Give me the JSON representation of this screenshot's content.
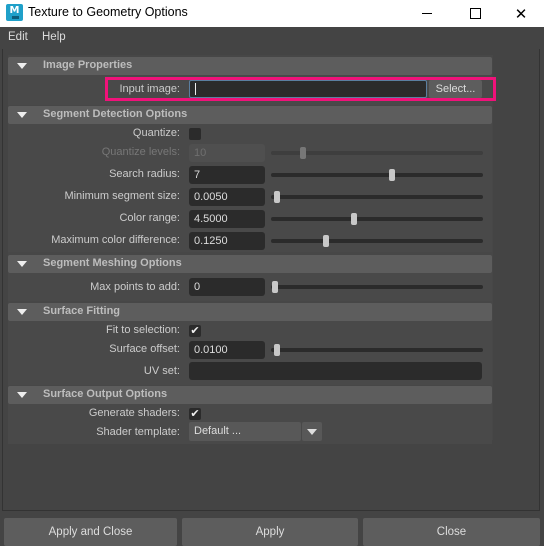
{
  "window": {
    "title": "Texture to Geometry Options",
    "app_icon_letter": "M",
    "controls": {
      "minimize": "minimize-icon",
      "maximize": "maximize-icon",
      "close": "✕"
    }
  },
  "menu": [
    "Edit",
    "Help"
  ],
  "sections": {
    "image_properties": {
      "title": "Image Properties",
      "input_image_label": "Input image:",
      "input_image_value": "",
      "select_label": "Select..."
    },
    "segment_detection": {
      "title": "Segment Detection Options",
      "quantize_label": "Quantize:",
      "quantize_checked": false,
      "quantize_levels_label": "Quantize levels:",
      "quantize_levels_value": "10",
      "quantize_levels_slider": 0.15,
      "search_radius_label": "Search radius:",
      "search_radius_value": "7",
      "search_radius_slider": 0.57,
      "min_segment_label": "Minimum segment size:",
      "min_segment_value": "0.0050",
      "min_segment_slider": 0.03,
      "color_range_label": "Color range:",
      "color_range_value": "4.5000",
      "color_range_slider": 0.39,
      "max_color_diff_label": "Maximum color difference:",
      "max_color_diff_value": "0.1250",
      "max_color_diff_slider": 0.26
    },
    "segment_meshing": {
      "title": "Segment Meshing Options",
      "max_points_label": "Max points to add:",
      "max_points_value": "0",
      "max_points_slider": 0.02
    },
    "surface_fitting": {
      "title": "Surface Fitting",
      "fit_selection_label": "Fit to selection:",
      "fit_selection_checked": true,
      "surface_offset_label": "Surface offset:",
      "surface_offset_value": "0.0100",
      "surface_offset_slider": 0.03,
      "uv_set_label": "UV set:",
      "uv_set_value": ""
    },
    "surface_output": {
      "title": "Surface Output Options",
      "generate_shaders_label": "Generate shaders:",
      "generate_shaders_checked": true,
      "shader_template_label": "Shader template:",
      "shader_template_value": "Default ..."
    }
  },
  "checkmark": "✔",
  "buttons": {
    "apply_close": "Apply and Close",
    "apply": "Apply",
    "close": "Close"
  },
  "colors": {
    "highlight": "#f0127a",
    "background": "#444444",
    "section_header": "#5d5d5d"
  }
}
